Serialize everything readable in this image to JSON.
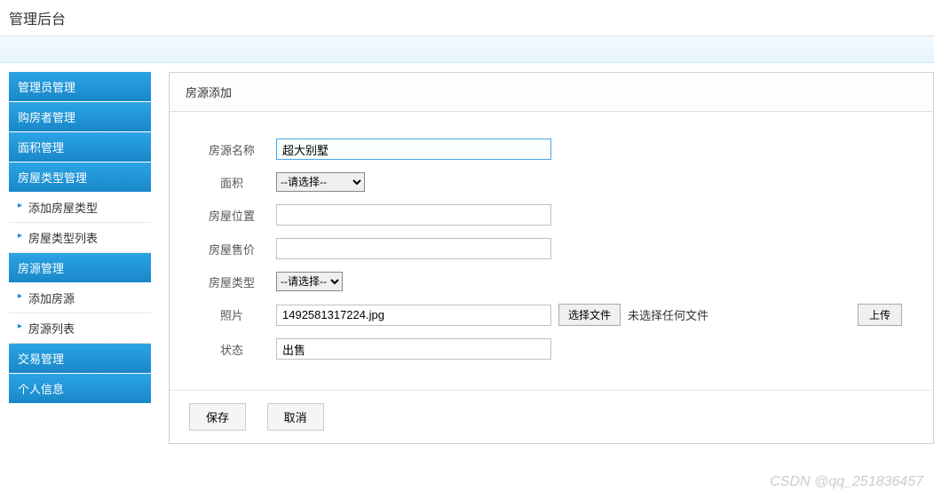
{
  "header": {
    "title": "管理后台"
  },
  "sidebar": {
    "groups": [
      {
        "label": "管理员管理",
        "items": []
      },
      {
        "label": "购房者管理",
        "items": []
      },
      {
        "label": "面积管理",
        "items": []
      },
      {
        "label": "房屋类型管理",
        "items": [
          "添加房屋类型",
          "房屋类型列表"
        ]
      },
      {
        "label": "房源管理",
        "items": [
          "添加房源",
          "房源列表"
        ]
      },
      {
        "label": "交易管理",
        "items": []
      },
      {
        "label": "个人信息",
        "items": []
      }
    ]
  },
  "panel": {
    "title": "房源添加"
  },
  "form": {
    "name": {
      "label": "房源名称",
      "value": "超大别墅"
    },
    "area": {
      "label": "面积",
      "value": "--请选择--"
    },
    "location": {
      "label": "房屋位置",
      "value": ""
    },
    "price": {
      "label": "房屋售价",
      "value": ""
    },
    "type": {
      "label": "房屋类型",
      "value": "--请选择--"
    },
    "photo": {
      "label": "照片",
      "value": "1492581317224.jpg",
      "choose": "选择文件",
      "none": "未选择任何文件",
      "upload": "上传"
    },
    "status": {
      "label": "状态",
      "value": "出售"
    }
  },
  "actions": {
    "save": "保存",
    "cancel": "取消"
  },
  "watermark": "CSDN @qq_251836457"
}
